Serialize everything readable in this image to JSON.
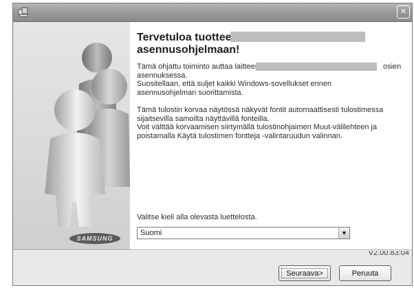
{
  "window": {
    "title": "",
    "close_label": "×"
  },
  "left_panel": {
    "logo_text": "SAMSUNG"
  },
  "main": {
    "title": "Tervetuloa tuotteen asennusohjelmaan!",
    "para1_line1": "Tämä ohjattu toiminto auttaa laitteen",
    "para1_line1_tail": "osien",
    "para1_rest": [
      "asennuksessa.",
      "Suositellaan, että suljet kaikki Windows-sovellukset ennen",
      "asennusohjelman suorittamista."
    ],
    "para2": [
      "Tämä tulostin korvaa näytössä näkyvät fontit automaattisesti tulostimessa",
      "sijaitsevilla samoilta näyttävillä fonteilla.",
      "Voit välttää korvaamisen siirtymällä tulostinohjaimen Muut-välilehteen ja",
      "poistamalla Käytä tulostimen fontteja -valintaruudun valinnan."
    ],
    "language_label": "Valitse kieli alla olevasta luettelosta.",
    "language_selected": "Suomi",
    "version": "V2.00.83:04"
  },
  "buttons": {
    "next_label": "Seuraava>",
    "cancel_label": "Peruuta"
  },
  "icons": {
    "app": "setup-icon",
    "close": "close-icon",
    "dropdown": "chevron-down-icon"
  },
  "colors": {
    "titlebar": "#9c9c9c",
    "redacted": "#bdbdbd"
  }
}
